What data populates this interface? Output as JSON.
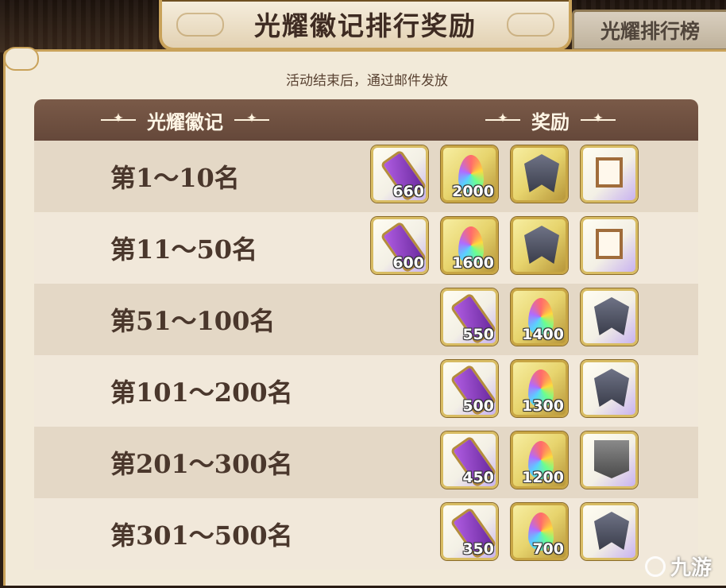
{
  "header": {
    "title": "光耀徽记排行奖励",
    "side_tab": "光耀排行榜"
  },
  "panel": {
    "subtitle": "活动结束后，通过邮件发放",
    "columns": {
      "rank": "光耀徽记",
      "reward": "奖励"
    }
  },
  "rows": [
    {
      "rank": "第1～10名",
      "rewards": [
        {
          "icon": "scroll-icon",
          "qty": "660"
        },
        {
          "icon": "crystal-icon",
          "qty": "2000"
        },
        {
          "icon": "crest-icon",
          "qty": ""
        },
        {
          "icon": "frame-icon",
          "qty": ""
        }
      ]
    },
    {
      "rank": "第11～50名",
      "rewards": [
        {
          "icon": "scroll-icon",
          "qty": "600"
        },
        {
          "icon": "crystal-icon",
          "qty": "1600"
        },
        {
          "icon": "crest-icon",
          "qty": ""
        },
        {
          "icon": "frame-icon",
          "qty": ""
        }
      ]
    },
    {
      "rank": "第51～100名",
      "rewards": [
        {
          "icon": "scroll-icon",
          "qty": "550"
        },
        {
          "icon": "crystal-icon",
          "qty": "1400"
        },
        {
          "icon": "crest-icon",
          "qty": ""
        }
      ]
    },
    {
      "rank": "第101～200名",
      "rewards": [
        {
          "icon": "scroll-icon",
          "qty": "500"
        },
        {
          "icon": "crystal-icon",
          "qty": "1300"
        },
        {
          "icon": "crest-icon",
          "qty": ""
        }
      ]
    },
    {
      "rank": "第201～300名",
      "rewards": [
        {
          "icon": "scroll-icon",
          "qty": "450"
        },
        {
          "icon": "crystal-icon",
          "qty": "1200"
        },
        {
          "icon": "banner-icon",
          "qty": ""
        }
      ]
    },
    {
      "rank": "第301～500名",
      "rewards": [
        {
          "icon": "scroll-icon",
          "qty": "350"
        },
        {
          "icon": "crystal-icon",
          "qty": "700"
        },
        {
          "icon": "crest-icon",
          "qty": ""
        }
      ]
    }
  ],
  "watermark": "九游"
}
